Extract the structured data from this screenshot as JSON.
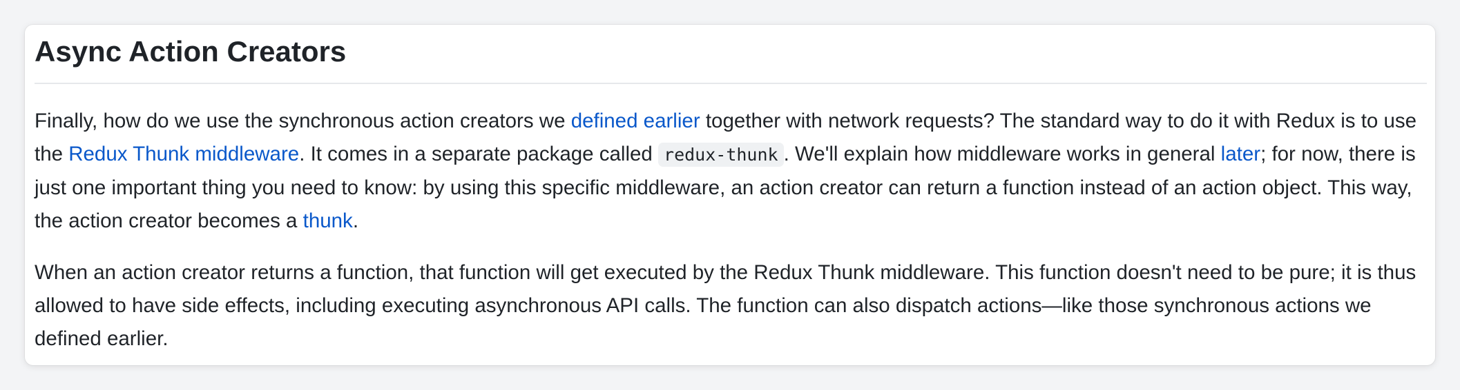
{
  "section": {
    "title": "Async Action Creators"
  },
  "paragraph1": {
    "t1": "Finally, how do we use the synchronous action creators we ",
    "link1": "defined earlier",
    "t2": " together with network requests? The standard way to do it with Redux is to use the ",
    "link2": "Redux Thunk middleware",
    "t3": ". It comes in a separate package called ",
    "code1": "redux-thunk",
    "t4": ". We'll explain how middleware works in general ",
    "link3": "later",
    "t5": "; for now, there is just one important thing you need to know: by using this specific middleware, an action creator can return a function instead of an action object. This way, the action creator becomes a ",
    "link4": "thunk",
    "t6": "."
  },
  "paragraph2": {
    "text": "When an action creator returns a function, that function will get executed by the Redux Thunk middleware. This function doesn't need to be pure; it is thus allowed to have side effects, including executing asynchronous API calls. The function can also dispatch actions—like those synchronous actions we defined earlier."
  },
  "colors": {
    "link": "#0a58ca",
    "text": "#1f2328",
    "code_background": "#eff1f3",
    "divider": "#e6e8eb"
  }
}
